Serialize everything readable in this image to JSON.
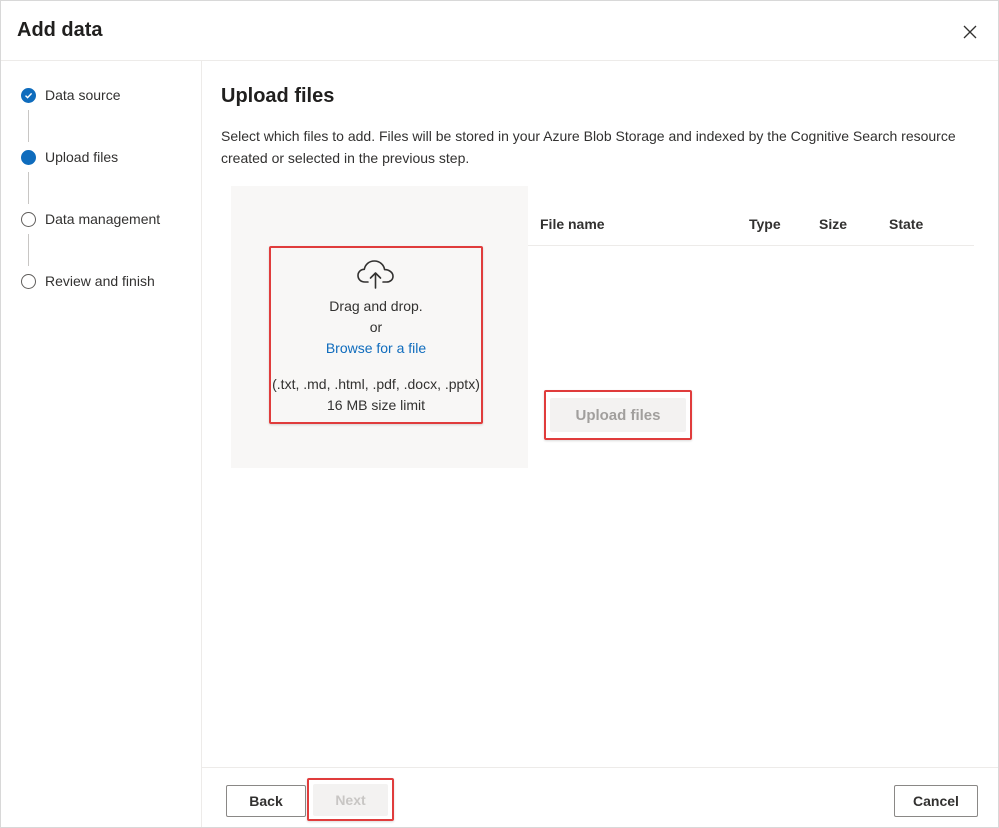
{
  "dialog": {
    "title": "Add data",
    "close_icon": "close-icon"
  },
  "steps": [
    {
      "label": "Data source",
      "status": "completed"
    },
    {
      "label": "Upload files",
      "status": "current"
    },
    {
      "label": "Data management",
      "status": "pending"
    },
    {
      "label": "Review and finish",
      "status": "pending"
    }
  ],
  "main": {
    "title": "Upload files",
    "description": "Select which files to add. Files will be stored in your Azure Blob Storage and indexed by the Cognitive Search resource created or selected in the previous step."
  },
  "dropzone": {
    "icon": "cloud-upload-icon",
    "line1": "Drag and drop.",
    "line2": "or",
    "browse_link": "Browse for a file",
    "formats": "(.txt, .md, .html, .pdf, .docx, .pptx)",
    "size_limit": "16 MB size limit"
  },
  "table": {
    "columns": [
      "File name",
      "Type",
      "Size",
      "State"
    ]
  },
  "upload_button": "Upload files",
  "footer": {
    "back": "Back",
    "next": "Next",
    "cancel": "Cancel"
  },
  "colors": {
    "accent": "#0f6cbd",
    "highlight_border": "#e03c3c"
  }
}
